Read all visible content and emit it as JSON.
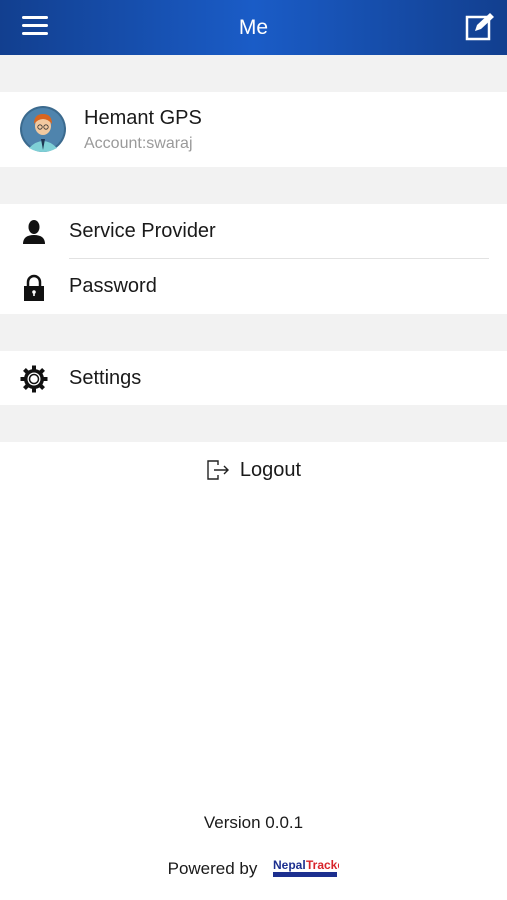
{
  "header": {
    "title": "Me"
  },
  "profile": {
    "name": "Hemant GPS",
    "account": "Account:swaraj"
  },
  "menu": {
    "service_provider": "Service Provider",
    "password": "Password",
    "settings": "Settings",
    "logout": "Logout"
  },
  "footer": {
    "version": "Version 0.0.1",
    "powered_by": "Powered by",
    "brand_logo_text": "NepalTracker"
  },
  "colors": {
    "header_blue": "#1a5cc7",
    "gap_gray": "#f2f2f2"
  },
  "icons": [
    "menu-icon",
    "edit-icon",
    "avatar",
    "person-icon",
    "lock-icon",
    "gear-icon",
    "logout-icon"
  ]
}
